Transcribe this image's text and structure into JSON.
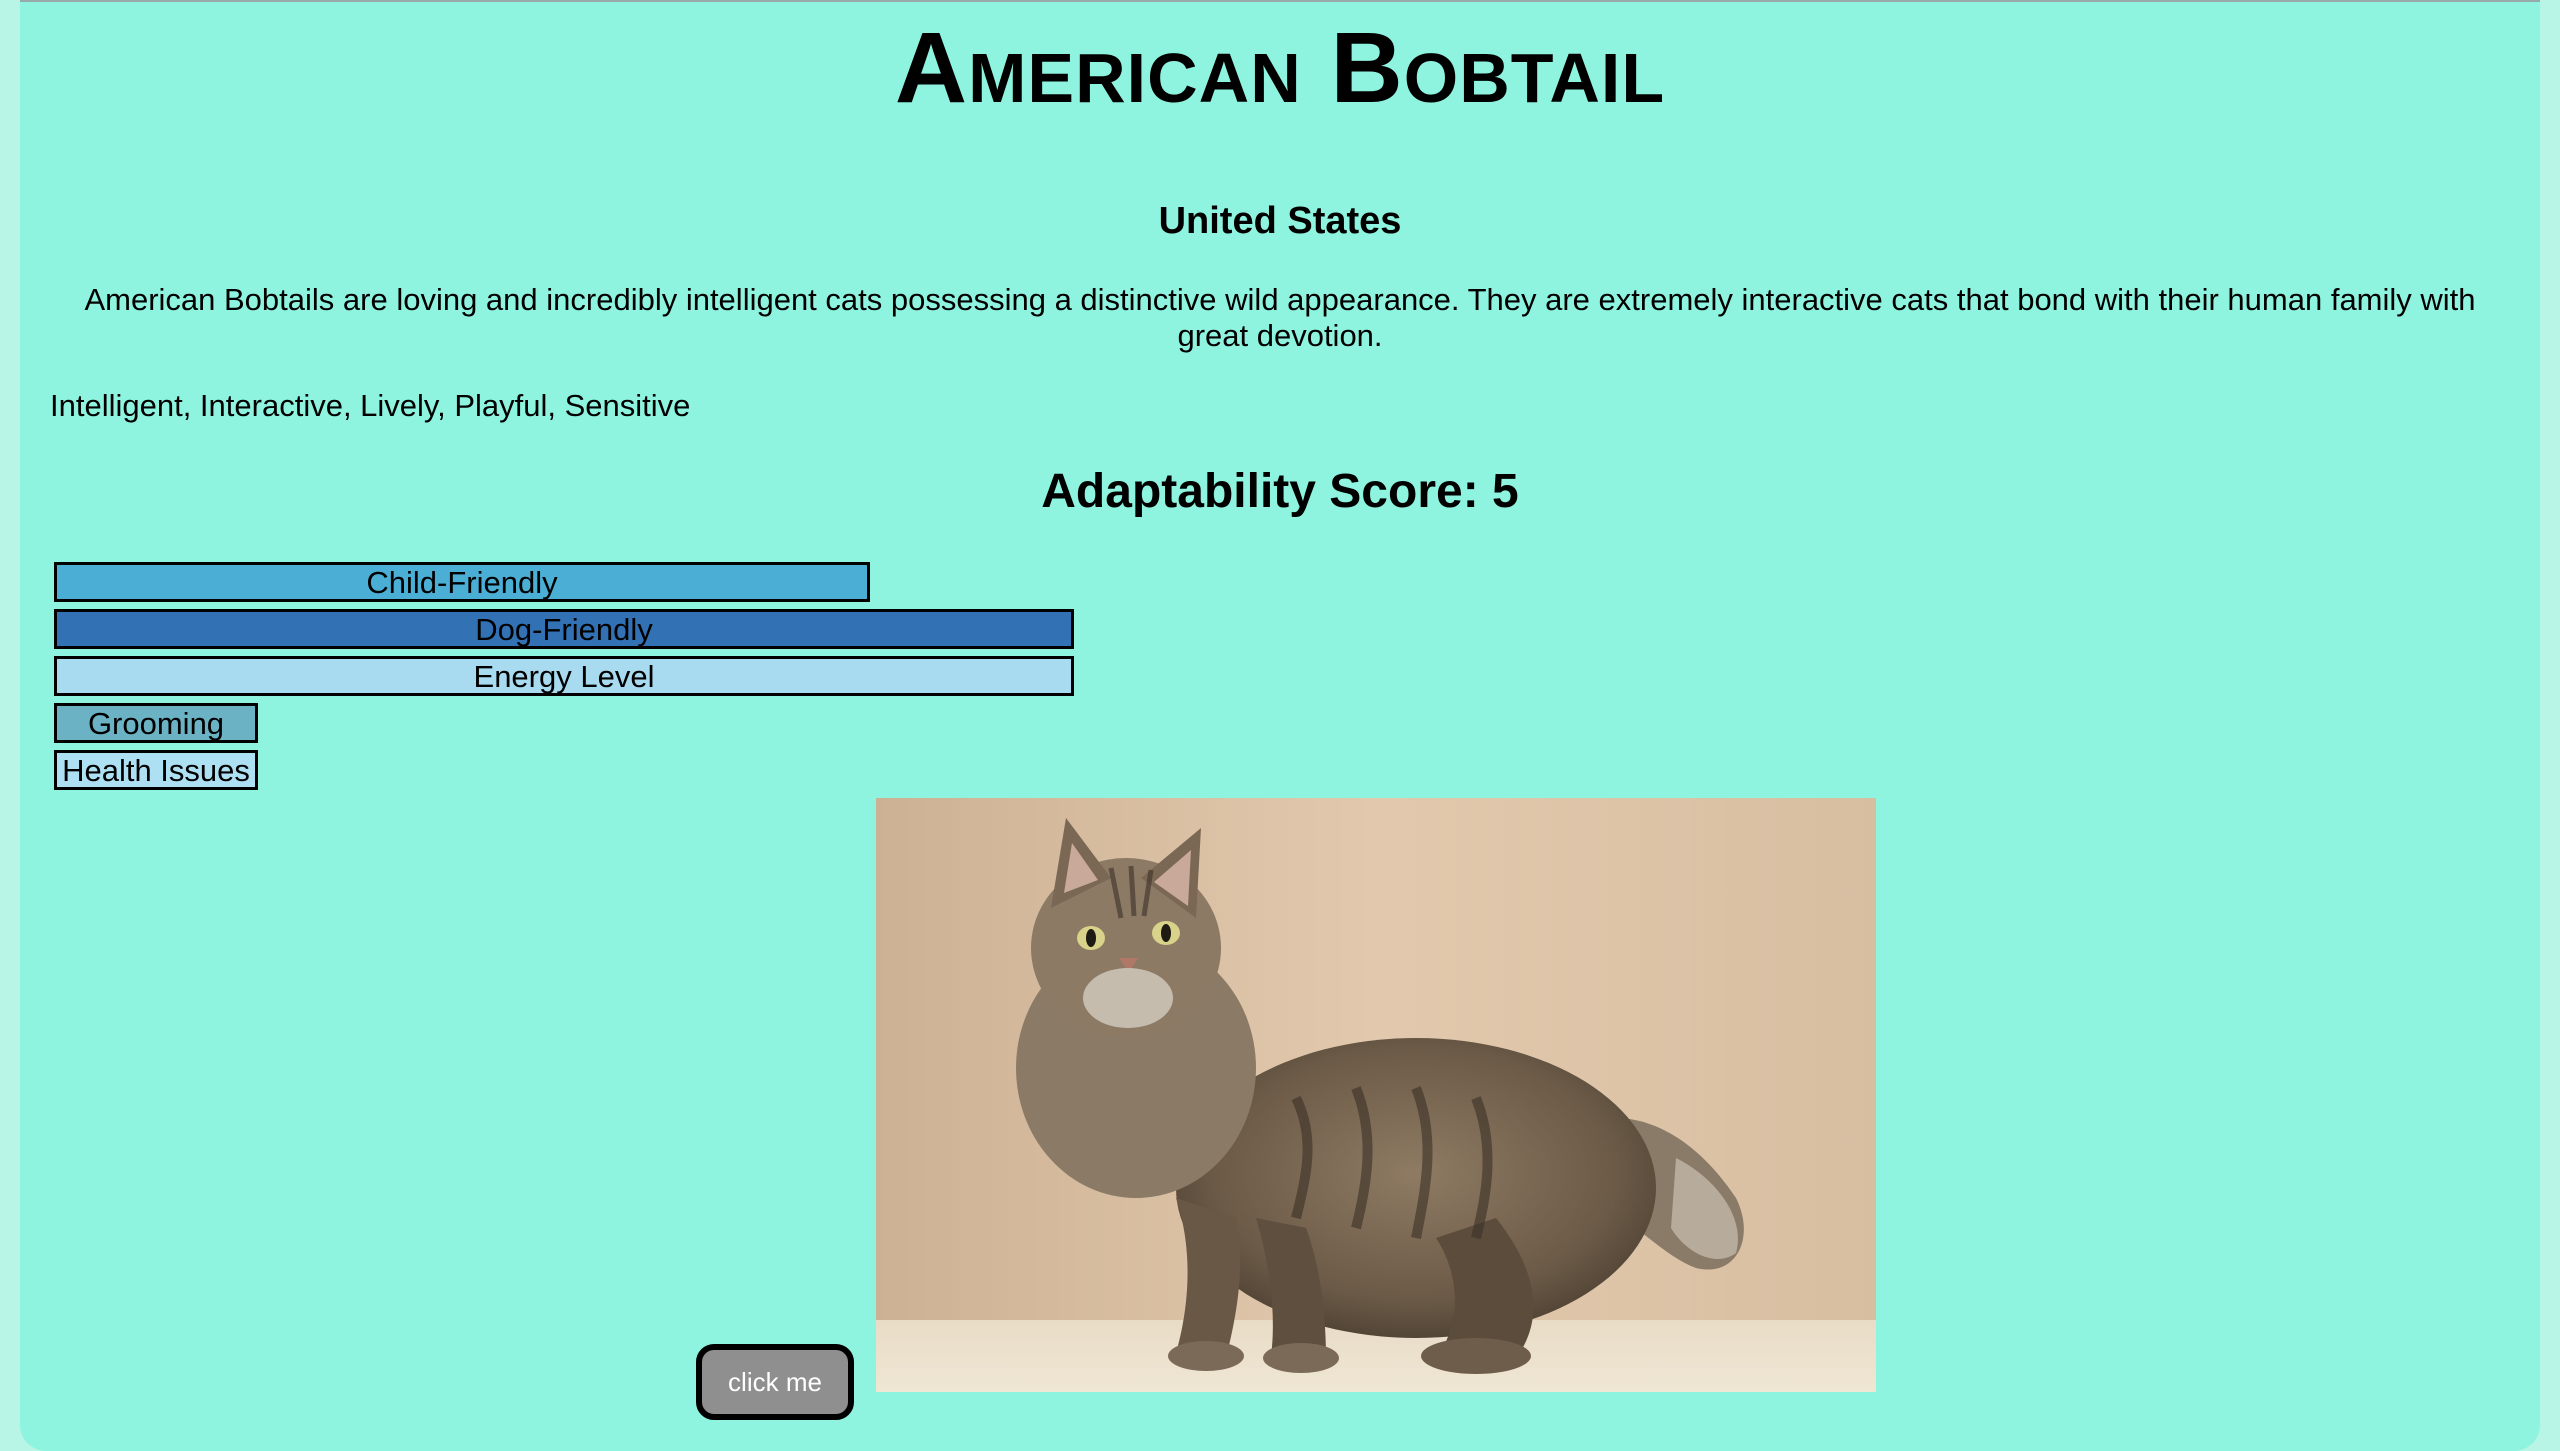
{
  "breed": {
    "name": "American Bobtail",
    "origin": "United States",
    "description": "American Bobtails are loving and incredibly intelligent cats possessing a distinctive wild appearance. They are extremely interactive cats that bond with their human family with great devotion.",
    "temperament": "Intelligent, Interactive, Lively, Playful, Sensitive"
  },
  "adaptability": {
    "label": "Adaptability Score: 5"
  },
  "traits": [
    {
      "label": "Child-Friendly",
      "score": 4,
      "max": 5,
      "color": "#4aaed5"
    },
    {
      "label": "Dog-Friendly",
      "score": 5,
      "max": 5,
      "color": "#3171b4"
    },
    {
      "label": "Energy Level",
      "score": 5,
      "max": 5,
      "color": "#a8dbef"
    },
    {
      "label": "Grooming",
      "score": 1,
      "max": 5,
      "color": "#6bb3c4"
    },
    {
      "label": "Health Issues",
      "score": 1,
      "max": 5,
      "color": "#aee0f3"
    }
  ],
  "button": {
    "label": "click me"
  },
  "colors": {
    "page_background": "#8ef3df",
    "outer_background": "#b8f5e6",
    "button_background": "#8f8f8f"
  }
}
